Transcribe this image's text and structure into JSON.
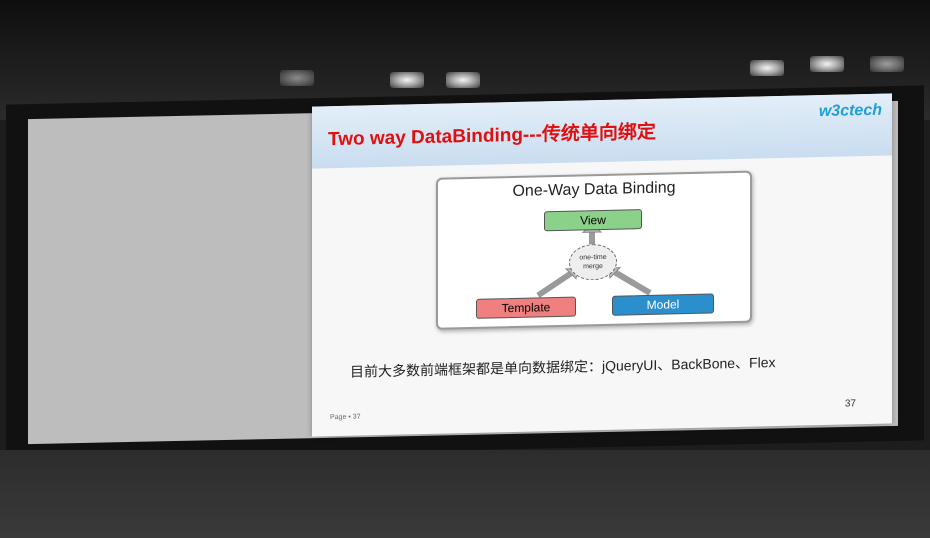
{
  "slide": {
    "title": "Two way DataBinding---传统单向绑定",
    "logo": "w3ctech",
    "diagram": {
      "title": "One-Way Data Binding",
      "view": "View",
      "template": "Template",
      "model": "Model",
      "merge_line1": "one-time",
      "merge_line2": "merge"
    },
    "face": "·  ·\n ⌒",
    "caption": "目前大多数前端框架都是单向数据绑定：jQueryUI、BackBone、Flex",
    "footer_left": "Page ▪ 37",
    "page_number": "37"
  }
}
